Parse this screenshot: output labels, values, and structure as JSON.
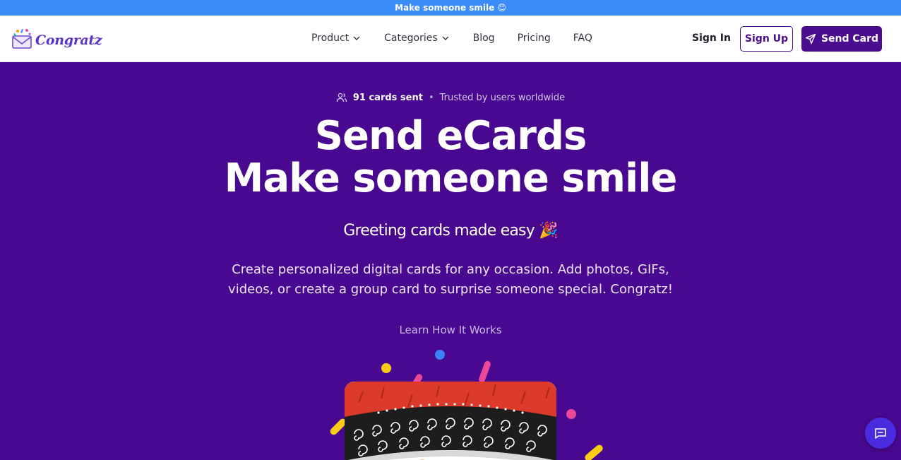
{
  "announcement": {
    "text": "Make someone smile 😊"
  },
  "brand": {
    "name": "Congratz",
    "logo_icon": "envelope-confetti-icon"
  },
  "nav": {
    "items": [
      {
        "label": "Product",
        "has_dropdown": true
      },
      {
        "label": "Categories",
        "has_dropdown": true
      },
      {
        "label": "Blog",
        "has_dropdown": false
      },
      {
        "label": "Pricing",
        "has_dropdown": false
      },
      {
        "label": "FAQ",
        "has_dropdown": false
      }
    ],
    "sign_in": "Sign In",
    "sign_up": "Sign Up",
    "send_card": "Send Card"
  },
  "hero": {
    "stats_count": "91 cards sent",
    "stats_trust": "Trusted by users worldwide",
    "stats_sep": "•",
    "headline_line1": "Send eCards",
    "headline_line2": "Make someone smile",
    "tagline": "Greeting cards made easy 🎉",
    "description": "Create personalized digital cards for any occasion. Add photos, GIFs, videos, or create a group card to surprise someone special. Congratz!",
    "learn_link": "Learn How It Works"
  },
  "colors": {
    "announce_bg": "#3b8cf6",
    "hero_bg": "#48088f",
    "primary": "#4b0d8f",
    "brand_text": "#5a34c8",
    "chat_button": "#4a2be0"
  },
  "icons": {
    "users": "users-icon",
    "send": "paper-plane-icon",
    "chat": "chat-bubble-icon",
    "chevron": "chevron-down-icon"
  }
}
